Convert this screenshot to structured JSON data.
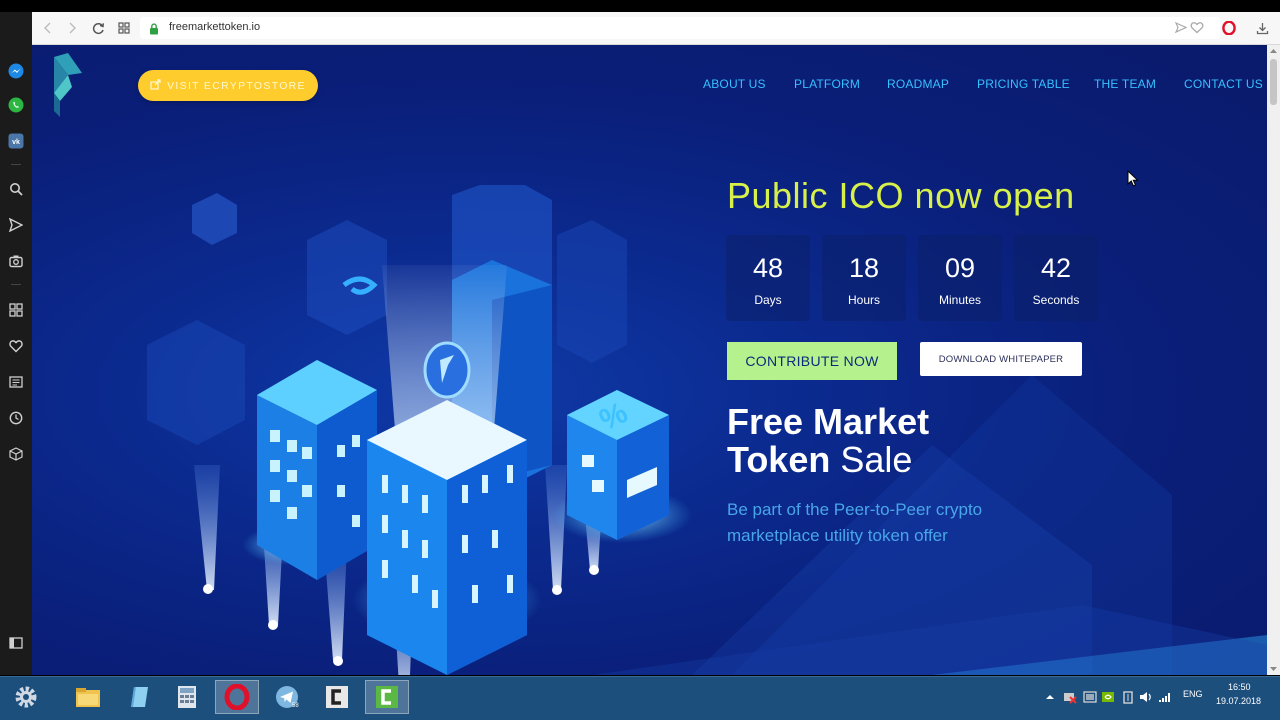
{
  "browser": {
    "url": "freemarkettoken.io"
  },
  "header": {
    "visit_button": "VISIT ECRYPTOSTORE",
    "nav": [
      "ABOUT US",
      "PLATFORM",
      "ROADMAP",
      "PRICING TABLE",
      "THE TEAM",
      "CONTACT US"
    ]
  },
  "hero": {
    "ico_title": "Public ICO now open",
    "countdown": [
      {
        "value": "48",
        "label": "Days"
      },
      {
        "value": "18",
        "label": "Hours"
      },
      {
        "value": "09",
        "label": "Minutes"
      },
      {
        "value": "42",
        "label": "Seconds"
      }
    ],
    "contribute_button": "CONTRIBUTE NOW",
    "whitepaper_button": "DOWNLOAD WHITEPAPER",
    "sale_title_bold": "Free Market",
    "sale_title_line2_bold": "Token",
    "sale_title_line2_thin": "Sale",
    "subtitle": "Be part of the Peer-to-Peer crypto marketplace utility token offer"
  },
  "taskbar": {
    "language": "ENG",
    "time": "16:50",
    "date": "19.07.2018"
  },
  "colors": {
    "page_bg": "#0a1f7a",
    "nav_link": "#35c0ff",
    "ico_title": "#d8f04a",
    "visit_button": "#ffcc2e",
    "contribute_button": "#b5f28d",
    "subtitle": "#48a6e8"
  }
}
